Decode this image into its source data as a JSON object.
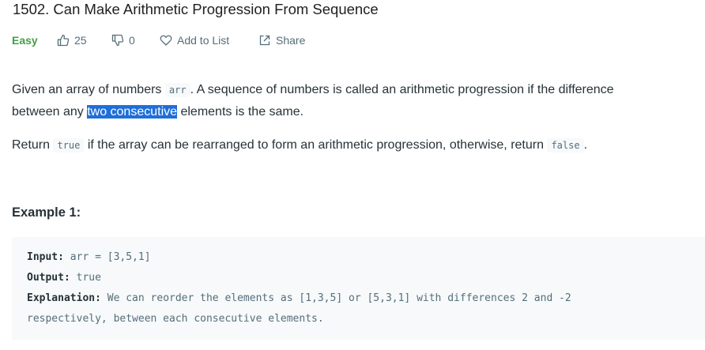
{
  "problem": {
    "title": "1502. Can Make Arithmetic Progression From Sequence",
    "difficulty": "Easy",
    "likes": "25",
    "dislikes": "0",
    "add_to_list_label": "Add to List",
    "share_label": "Share"
  },
  "description": {
    "p1_a": "Given an array of numbers ",
    "p1_code": "arr",
    "p1_b": ". A sequence of numbers is called an arithmetic progression if the difference",
    "p1_c": "between any ",
    "p1_highlight": "two consecutive",
    "p1_d": " elements is the same.",
    "p2_a": "Return ",
    "p2_code1": "true",
    "p2_b": " if the array can be rearranged to form an arithmetic progression, otherwise, return ",
    "p2_code2": "false",
    "p2_c": "."
  },
  "example": {
    "heading": "Example 1:",
    "input_label": "Input:",
    "input_value": " arr = [3,5,1]",
    "output_label": "Output:",
    "output_value": " true",
    "explanation_label": "Explanation:",
    "explanation_value": " We can reorder the elements as [1,3,5] or [5,3,1] with differences 2 and -2",
    "explanation_cont": "respectively, between each consecutive elements."
  },
  "colors": {
    "easy": "#43a047",
    "highlight": "#1e6fd9",
    "code_bg": "#f7f9fa"
  },
  "icons": [
    "thumbs-up-icon",
    "thumbs-down-icon",
    "heart-icon",
    "share-icon"
  ]
}
